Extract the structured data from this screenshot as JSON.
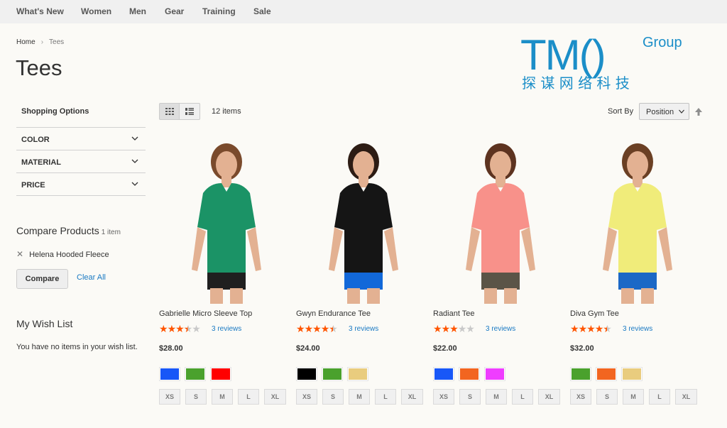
{
  "nav": {
    "items": [
      {
        "label": "What's New"
      },
      {
        "label": "Women"
      },
      {
        "label": "Men"
      },
      {
        "label": "Gear"
      },
      {
        "label": "Training"
      },
      {
        "label": "Sale"
      }
    ]
  },
  "breadcrumb": {
    "home": "Home",
    "separator": "›",
    "current": "Tees"
  },
  "page": {
    "title": "Tees"
  },
  "watermark": {
    "brand": "TM()",
    "group": "Group",
    "chinese": "探 谋 网 络 科 技",
    "color": "#1b8ec8"
  },
  "sidebar": {
    "filters_title": "Shopping Options",
    "filters": [
      {
        "label": "COLOR"
      },
      {
        "label": "MATERIAL"
      },
      {
        "label": "PRICE"
      }
    ],
    "compare": {
      "title": "Compare Products",
      "count": "1 item",
      "items": [
        {
          "name": "Helena Hooded Fleece",
          "remove_icon": "close-icon"
        }
      ],
      "compare_label": "Compare",
      "clear_label": "Clear All"
    },
    "wishlist": {
      "title": "My Wish List",
      "empty_text": "You have no items in your wish list."
    }
  },
  "toolbar": {
    "view_modes": [
      "grid-icon",
      "list-icon"
    ],
    "active_mode": "grid",
    "item_count": "12 items",
    "sort_label": "Sort By",
    "sort_value": "Position",
    "sort_direction_icon": "arrow-up-icon"
  },
  "products": [
    {
      "name": "Gabrielle Micro Sleeve Top",
      "rating": 3.5,
      "reviews": "3 reviews",
      "price": "$28.00",
      "swatches": [
        "#1857f7",
        "#4aa12d",
        "#ff0000"
      ],
      "sizes": [
        "XS",
        "S",
        "M",
        "L",
        "XL"
      ],
      "shirt_color": "#1b9366",
      "shorts_color": "#1f1f1f"
    },
    {
      "name": "Gwyn Endurance Tee",
      "rating": 4.5,
      "reviews": "3 reviews",
      "price": "$24.00",
      "swatches": [
        "#000000",
        "#4aa12d",
        "#e9cc7e"
      ],
      "sizes": [
        "XS",
        "S",
        "M",
        "L",
        "XL"
      ],
      "shirt_color": "#151515",
      "shorts_color": "#1268d9"
    },
    {
      "name": "Radiant Tee",
      "rating": 3,
      "reviews": "3 reviews",
      "price": "$22.00",
      "swatches": [
        "#1857f7",
        "#f26520",
        "#ef3dff"
      ],
      "sizes": [
        "XS",
        "S",
        "M",
        "L",
        "XL"
      ],
      "shirt_color": "#f8918a",
      "shorts_color": "#5b5447"
    },
    {
      "name": "Diva Gym Tee",
      "rating": 4.5,
      "reviews": "3 reviews",
      "price": "$32.00",
      "swatches": [
        "#4aa12d",
        "#f26520",
        "#e9cc7e"
      ],
      "sizes": [
        "XS",
        "S",
        "M",
        "L",
        "XL"
      ],
      "shirt_color": "#f0ec7a",
      "shorts_color": "#1b68c6"
    }
  ]
}
